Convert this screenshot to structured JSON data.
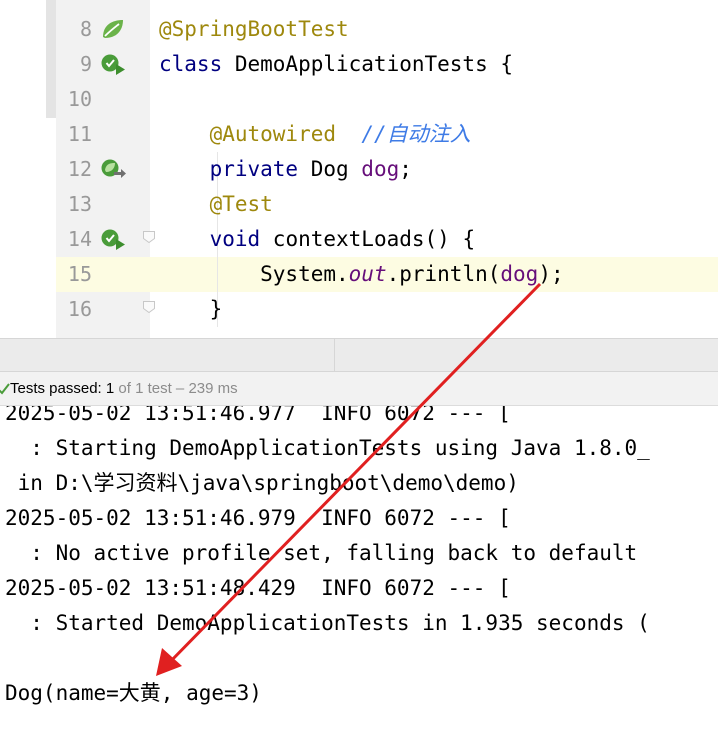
{
  "editor": {
    "lines": [
      {
        "num": "8",
        "parts": [
          {
            "t": "@SpringBootTest",
            "c": "ann"
          }
        ],
        "icon": "spring-leaf-icon"
      },
      {
        "num": "9",
        "parts": [
          {
            "t": "class ",
            "c": "kw"
          },
          {
            "t": "DemoApplicationTests {",
            "c": ""
          }
        ],
        "icon": "run-test-icon"
      },
      {
        "num": "10",
        "parts": []
      },
      {
        "num": "11",
        "parts": [
          {
            "t": "    @Autowired",
            "c": "ann"
          },
          {
            "t": "  ",
            "c": ""
          },
          {
            "t": "//自动注入",
            "c": "cmt"
          }
        ]
      },
      {
        "num": "12",
        "parts": [
          {
            "t": "    private ",
            "c": "kw"
          },
          {
            "t": "Dog ",
            "c": ""
          },
          {
            "t": "dog",
            "c": "fld"
          },
          {
            "t": ";",
            "c": ""
          }
        ],
        "icon": "autowired-bean-icon"
      },
      {
        "num": "13",
        "parts": [
          {
            "t": "    @Test",
            "c": "ann"
          }
        ]
      },
      {
        "num": "14",
        "parts": [
          {
            "t": "    void ",
            "c": "kw"
          },
          {
            "t": "contextLoads() {",
            "c": ""
          }
        ],
        "icon": "run-test-icon",
        "fold": true
      },
      {
        "num": "15",
        "parts": [
          {
            "t": "        System.",
            "c": ""
          },
          {
            "t": "out",
            "c": "sfld"
          },
          {
            "t": ".println(",
            "c": ""
          },
          {
            "t": "dog",
            "c": "fld"
          },
          {
            "t": ");",
            "c": ""
          }
        ],
        "current": true
      },
      {
        "num": "16",
        "parts": [
          {
            "t": "    }",
            "c": ""
          }
        ],
        "fold": true
      }
    ]
  },
  "status": {
    "prefix": "Tests passed: ",
    "passed": "1",
    "suffix": " of 1 test – 239 ms"
  },
  "console": {
    "lines": [
      "2025-05-02 13:51:46.977  INFO 6072 --- [",
      "  : Starting DemoApplicationTests using Java 1.8.0_",
      " in D:\\学习资料\\java\\springboot\\demo\\demo)",
      "2025-05-02 13:51:46.979  INFO 6072 --- [",
      "  : No active profile set, falling back to default",
      "2025-05-02 13:51:48.429  INFO 6072 --- [",
      "  : Started DemoApplicationTests in 1.935 seconds (",
      "",
      "Dog(name=大黄, age=3)"
    ]
  },
  "colors": {
    "annotation": "#9e880d",
    "keyword": "#000080",
    "field": "#660e7a",
    "comment": "#3e7be6",
    "arrow": "#e02020",
    "passed": "#4a9c3a"
  }
}
